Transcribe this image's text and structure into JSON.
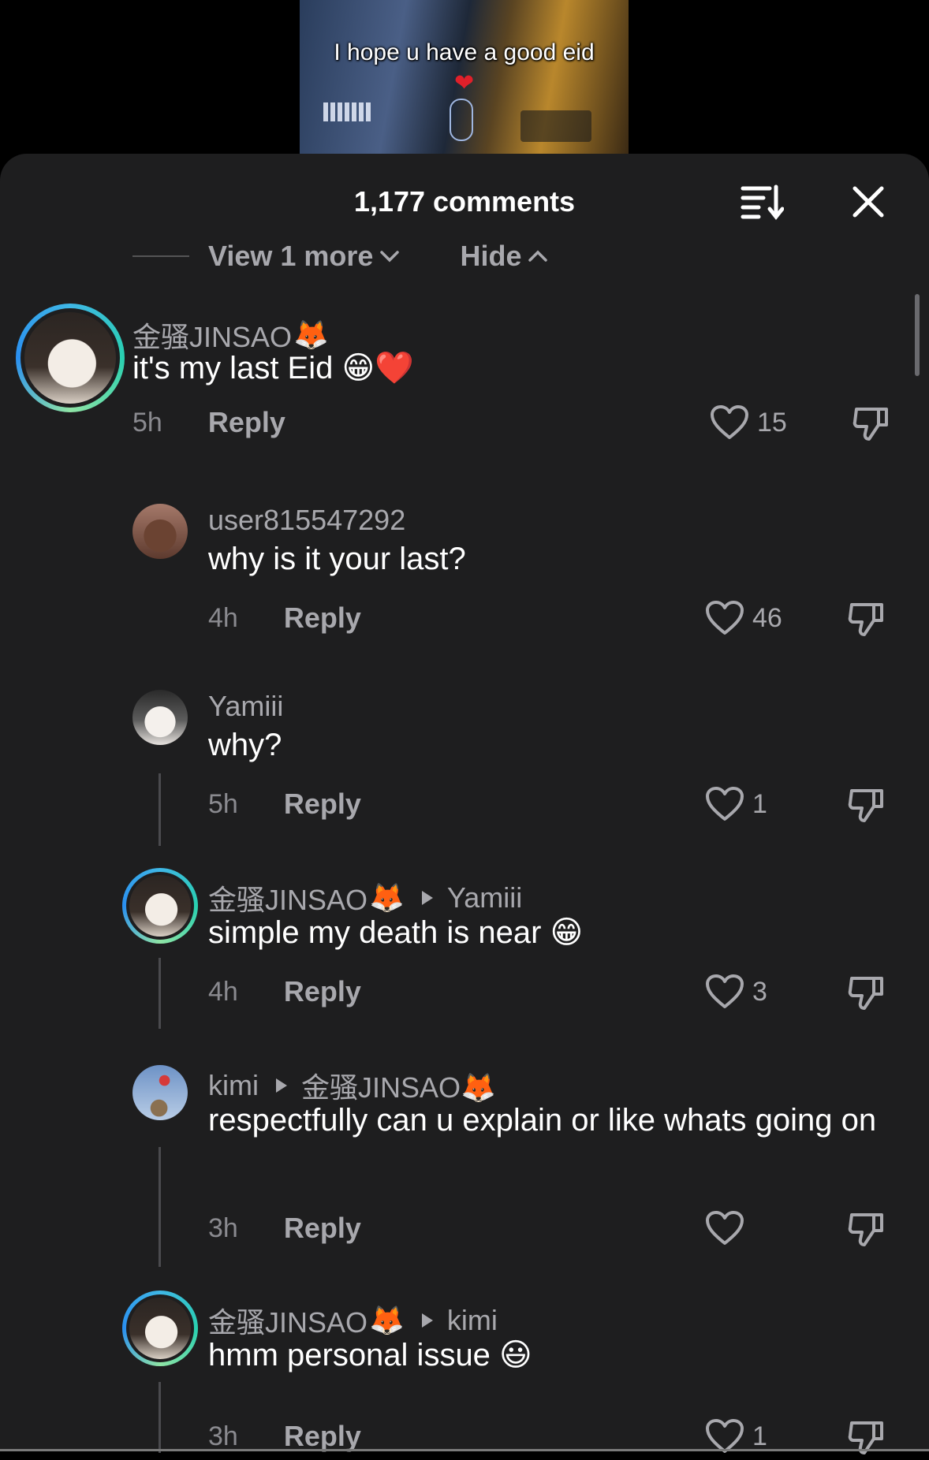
{
  "video": {
    "caption": "I hope u have a good eid",
    "heart": "❤"
  },
  "header": {
    "title": "1,177 comments"
  },
  "thread_controls": {
    "view_more": "View 1 more",
    "hide": "Hide"
  },
  "comments": [
    {
      "user": "金骚JINSAO",
      "user_emoji": "🦊",
      "text": "it's my last Eid 😁❤️",
      "time": "5h",
      "reply": "Reply",
      "likes": "15"
    },
    {
      "user": "user815547292",
      "text": "why is it your last?",
      "time": "4h",
      "reply": "Reply",
      "likes": "46"
    },
    {
      "user": "Yamiii",
      "text": "why?",
      "time": "5h",
      "reply": "Reply",
      "likes": "1"
    },
    {
      "user": "金骚JINSAO",
      "user_emoji": "🦊",
      "reply_to": "Yamiii",
      "text": "simple my death is near 😁",
      "time": "4h",
      "reply": "Reply",
      "likes": "3"
    },
    {
      "user": "kimi",
      "reply_to": "金骚JINSAO🦊",
      "text": "respectfully can u explain or like whats going on",
      "time": "3h",
      "reply": "Reply",
      "likes": ""
    },
    {
      "user": "金骚JINSAO",
      "user_emoji": "🦊",
      "reply_to": "kimi",
      "text": "hmm personal issue 😃",
      "time": "3h",
      "reply": "Reply",
      "likes": "1"
    }
  ],
  "icons": {
    "sort": "sort-icon",
    "close": "close-icon",
    "like": "heart-icon",
    "dislike": "thumbs-down-icon"
  },
  "colors": {
    "sheet_bg": "#1e1e1f",
    "muted_text": "#a8a8ad",
    "ring_accent": "#3fb7e6"
  }
}
